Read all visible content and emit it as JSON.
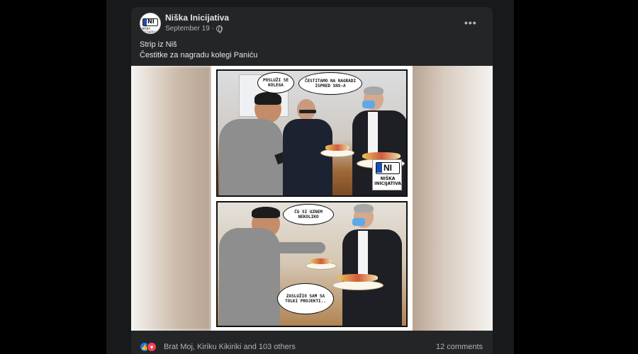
{
  "post": {
    "page_name": "Niška Inicijativa",
    "date": "September 19",
    "separator": "·",
    "avatar_text": "NI",
    "avatar_subtext": "NIŠKA INICIJATIVA",
    "caption_line1": "Strip iz Niš",
    "caption_line2": "Čestitke za nagradu kolegi Paniću",
    "more_label": "•••"
  },
  "comic": {
    "panel1_bubble_left": "POSLUŽI SE KOLEGA",
    "panel1_bubble_right": "ČESTITAMO NA NAGRADI ISPRED SNS-A",
    "panel2_bubble_top": "ĆU SI UZNEM NEKOLIKO",
    "panel2_bubble_bottom": "ZASLUŽIO SAM SA TOLKI PROJEKTI..",
    "logo_ni": "NI",
    "logo_srb": "SRB",
    "logo_name": "NIŠKA INICIJATIVA"
  },
  "footer": {
    "reaction_names": "Brat Moj, Kiriku Kikiriki and 103 others",
    "comments": "12 comments",
    "like_icon": "thumbs-up",
    "love_icon": "heart"
  },
  "colors": {
    "card_bg": "#242526",
    "text_primary": "#e4e6eb",
    "text_secondary": "#b0b3b8",
    "like_blue": "#1877f2",
    "love_red": "#f33e58"
  }
}
